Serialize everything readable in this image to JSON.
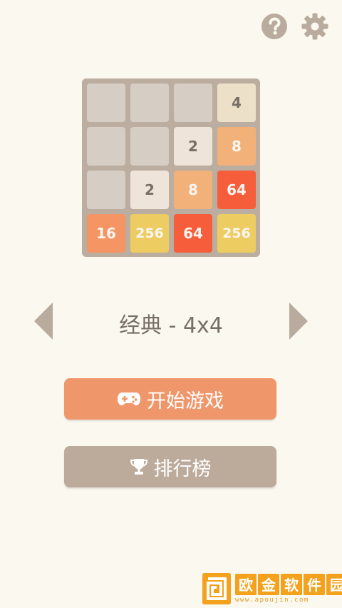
{
  "top_bar": {
    "help_icon": "question-circle-icon",
    "settings_icon": "gear-icon",
    "icon_color": "#b9ab9d"
  },
  "board": {
    "size": 4,
    "tiles": [
      [
        "",
        "",
        "",
        "4"
      ],
      [
        "",
        "",
        "2",
        "8"
      ],
      [
        "",
        "2",
        "8",
        "64"
      ],
      [
        "16",
        "256",
        "64",
        "256"
      ]
    ],
    "empty_color": "#d6cdc4",
    "tile_colors": {
      "2": {
        "bg": "#eee4da",
        "fg": "#776e65"
      },
      "4": {
        "bg": "#ede0c8",
        "fg": "#776e65"
      },
      "8": {
        "bg": "#f2b179",
        "fg": "#f9f6f2"
      },
      "16": {
        "bg": "#f59563",
        "fg": "#f9f6f2"
      },
      "64": {
        "bg": "#f65e3b",
        "fg": "#f9f6f2"
      },
      "256": {
        "bg": "#edcc61",
        "fg": "#f9f6f2"
      }
    }
  },
  "mode_selector": {
    "label": "经典 - 4x4",
    "prev_icon": "chevron-left-icon",
    "next_icon": "chevron-right-icon"
  },
  "buttons": {
    "start_label": "开始游戏",
    "start_icon": "gamepad-icon",
    "rank_label": "排行榜",
    "rank_icon": "trophy-icon"
  },
  "watermark": {
    "chars": [
      "欧",
      "金",
      "软",
      "件",
      "园"
    ],
    "url": "www.apoujin.com"
  }
}
